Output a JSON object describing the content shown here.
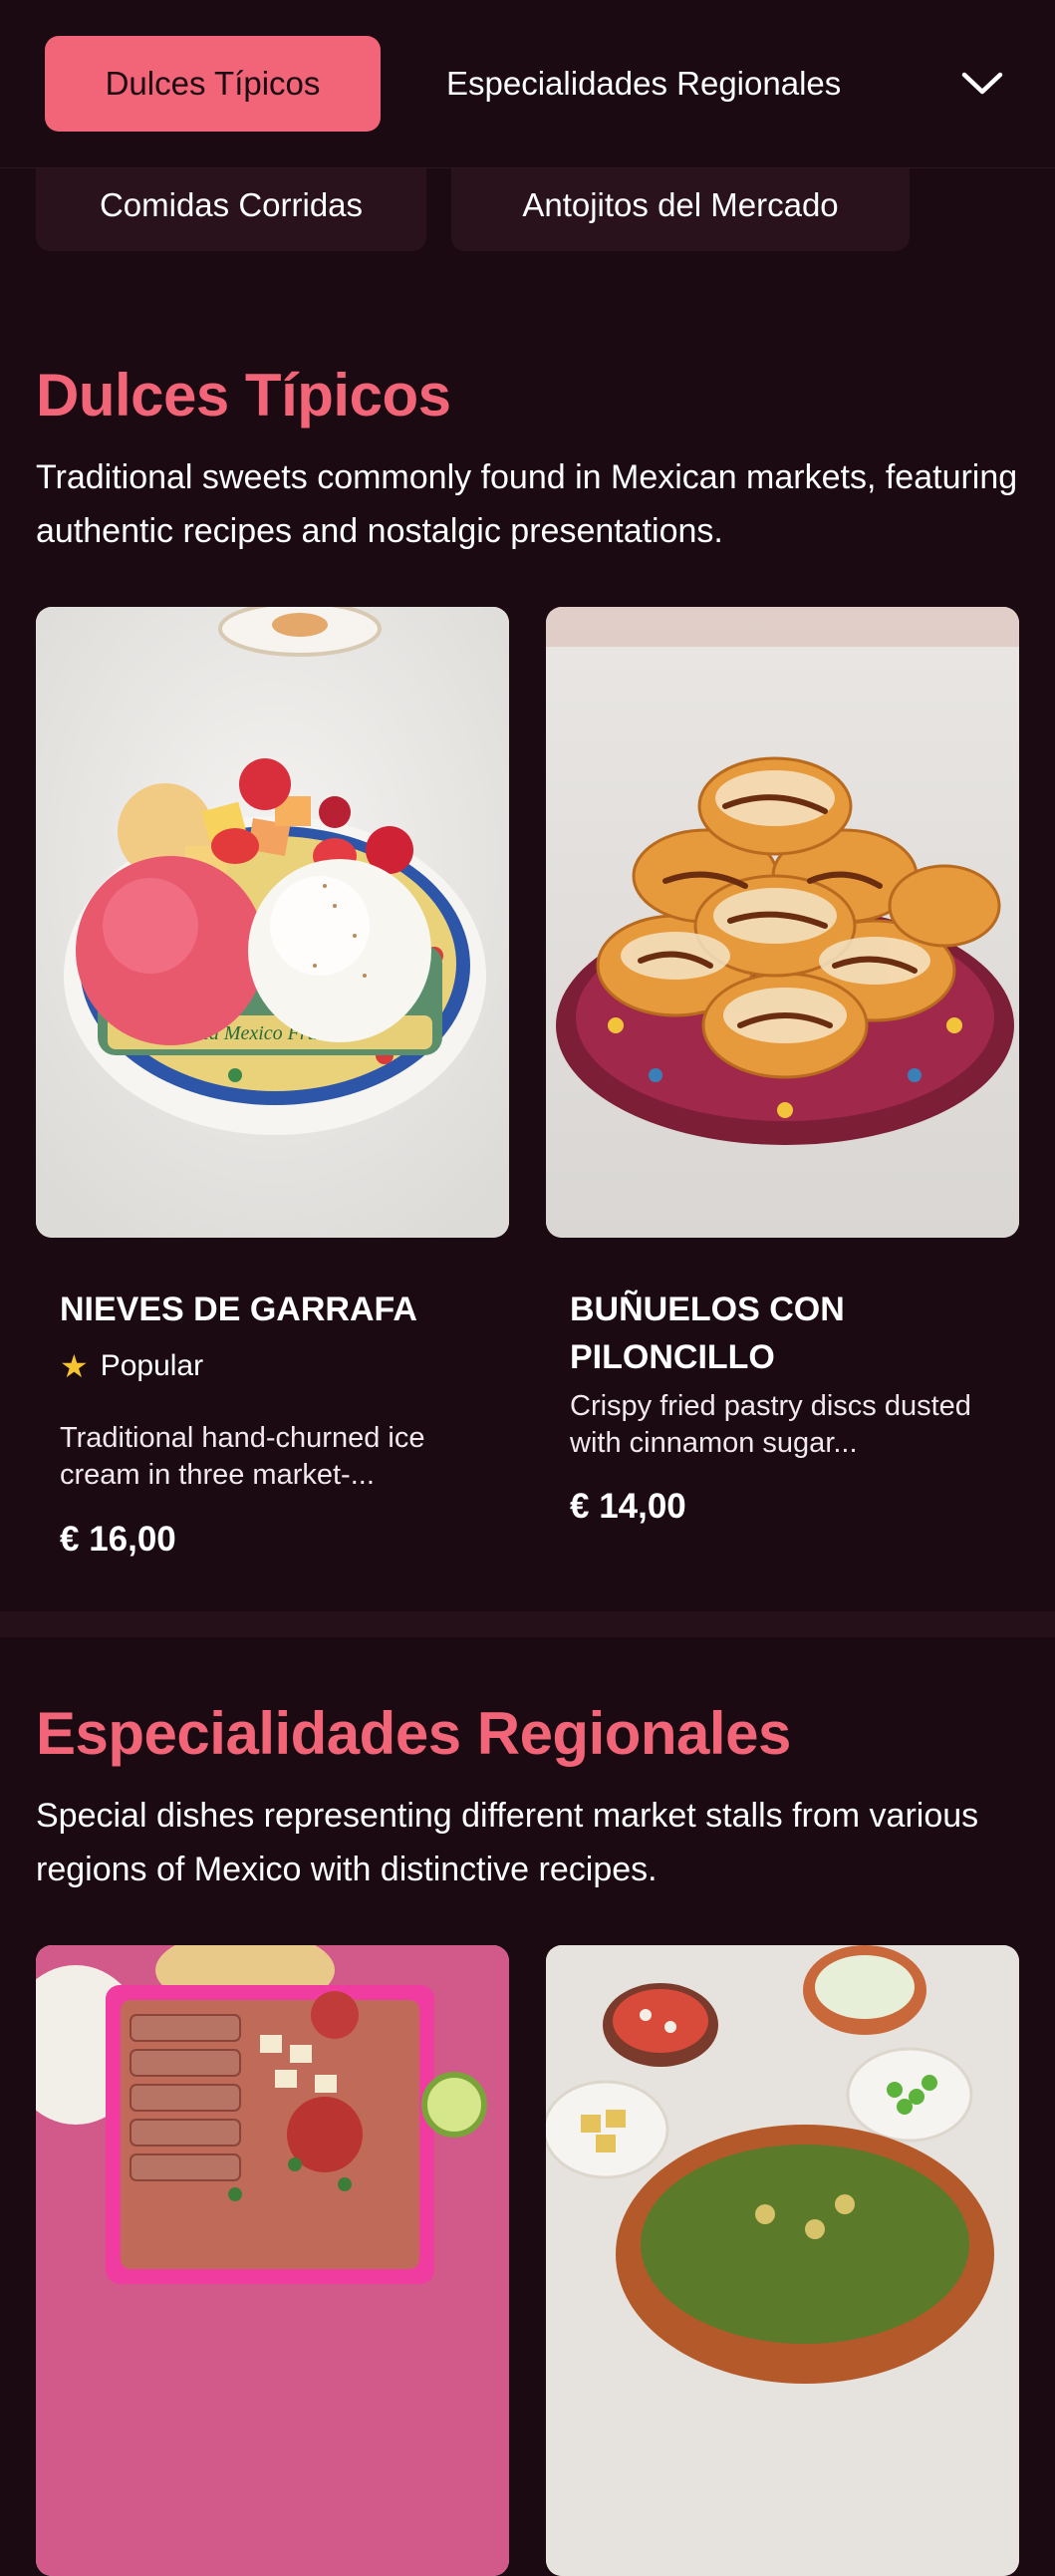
{
  "nav": {
    "active_tab": "Dulces Típicos",
    "tab_2": "Especialidades Regionales",
    "subtabs": [
      "Comidas Corridas",
      "Antojitos del Mercado"
    ]
  },
  "sections": [
    {
      "title": "Dulces Típicos",
      "description": "Traditional sweets commonly found in Mexican markets, featuring authentic recipes and nostalgic presentations.",
      "items": [
        {
          "name": "NIEVES DE GARRAFA",
          "badge": "Popular",
          "description": "Traditional hand-churned ice cream in three market-...",
          "price": "€ 16,00",
          "image_text": "Froid Mexico Frunk Ice"
        },
        {
          "name": "BUÑUELOS CON PILONCILLO",
          "description": "Crispy fried pastry discs dusted with cinnamon sugar...",
          "price": "€ 14,00"
        }
      ]
    },
    {
      "title": "Especialidades Regionales",
      "description": "Special dishes representing different market stalls from various regions of Mexico with distinctive recipes."
    }
  ],
  "colors": {
    "background": "#1c0a12",
    "accent": "#f26477",
    "chip": "#2a121c",
    "star": "#f6c431"
  },
  "icons": [
    "chevron-down-icon",
    "star-icon"
  ]
}
